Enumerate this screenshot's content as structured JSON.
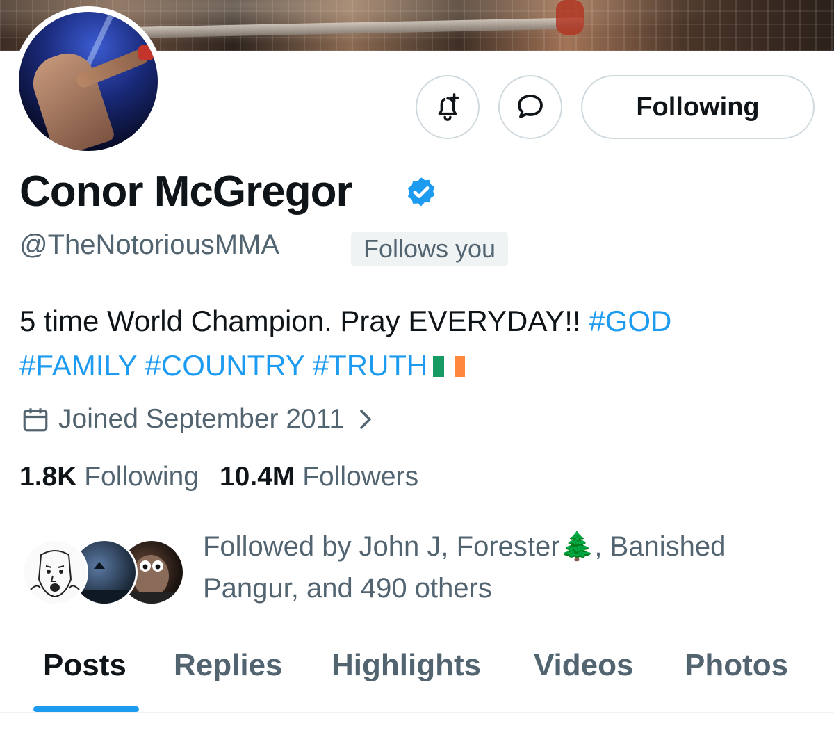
{
  "profile": {
    "display_name": "Conor McGregor",
    "handle": "@TheNotoriousMMA",
    "follows_you_badge": "Follows you",
    "bio": {
      "text": "5 time World Champion. Pray EVERYDAY!! ",
      "hashtags": [
        "#GOD",
        "#FAMILY",
        "#COUNTRY",
        "#TRUTH"
      ],
      "flag_colors": [
        "#169b62",
        "#ffffff",
        "#ff883e"
      ]
    },
    "joined": "Joined September 2011",
    "following_count": "1.8K",
    "following_label": "Following",
    "followers_count": "10.4M",
    "followers_label": "Followers",
    "followed_by_1": "Followed by John J, Forester🌲, Banished",
    "followed_by_2": "Pangur, and 490 others"
  },
  "actions": {
    "notify_icon": "bell-plus-icon",
    "message_icon": "message-bubble-icon",
    "following_button": "Following"
  },
  "tabs": [
    "Posts",
    "Replies",
    "Highlights",
    "Videos",
    "Photos"
  ],
  "active_tab": "Posts",
  "colors": {
    "accent": "#1d9bf0",
    "text_primary": "#0f1419",
    "text_secondary": "#536471",
    "border": "#cfd9de",
    "badge_bg": "#eff3f4"
  }
}
